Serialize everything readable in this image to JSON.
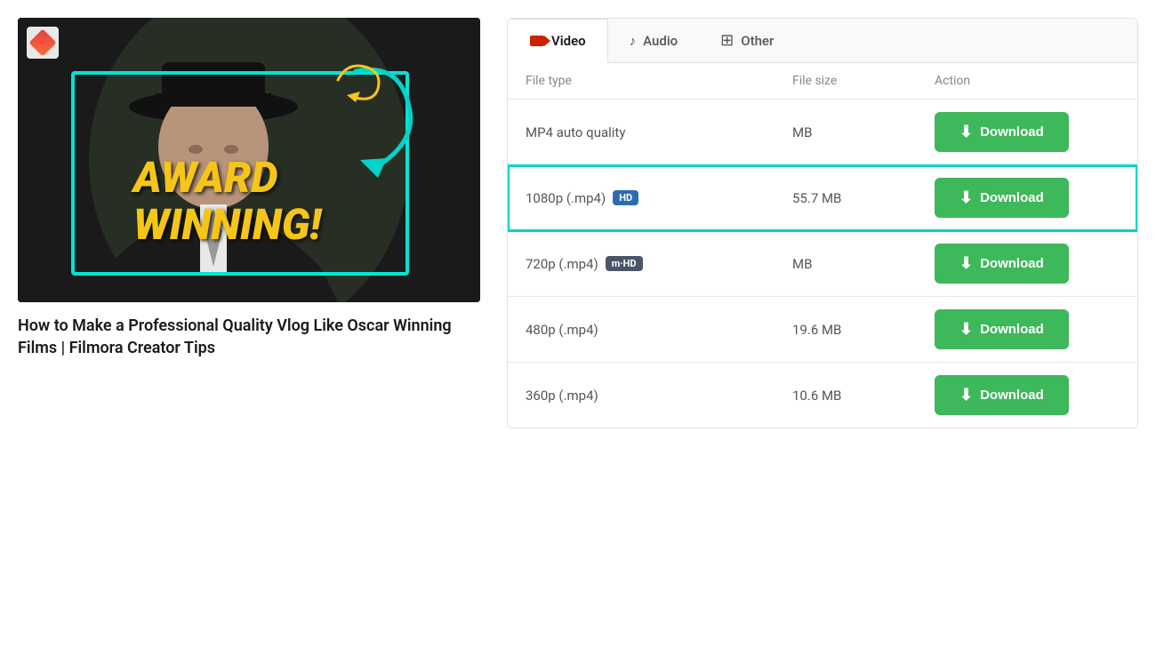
{
  "left": {
    "title": "How to Make a Professional Quality Vlog Like Oscar Winning Films | Filmora Creator Tips"
  },
  "tabs": [
    {
      "id": "video",
      "label": "Video",
      "active": true
    },
    {
      "id": "audio",
      "label": "Audio",
      "active": false
    },
    {
      "id": "other",
      "label": "Other",
      "active": false
    }
  ],
  "table": {
    "columns": {
      "file_type": "File type",
      "file_size": "File size",
      "action": "Action"
    },
    "rows": [
      {
        "id": "mp4-auto",
        "file_type": "MP4 auto quality",
        "badge": null,
        "file_size": "MB",
        "btn_label": "Download",
        "highlighted": false
      },
      {
        "id": "1080p",
        "file_type": "1080p (.mp4)",
        "badge": "HD",
        "badge_class": "hd",
        "file_size": "55.7 MB",
        "btn_label": "Download",
        "highlighted": true
      },
      {
        "id": "720p",
        "file_type": "720p (.mp4)",
        "badge": "m·HD",
        "badge_class": "mhd",
        "file_size": "MB",
        "btn_label": "Download",
        "highlighted": false
      },
      {
        "id": "480p",
        "file_type": "480p (.mp4)",
        "badge": null,
        "file_size": "19.6 MB",
        "btn_label": "Download",
        "highlighted": false
      },
      {
        "id": "360p",
        "file_type": "360p (.mp4)",
        "badge": null,
        "file_size": "10.6 MB",
        "btn_label": "Download",
        "highlighted": false
      }
    ]
  },
  "icons": {
    "download": "⬇",
    "music": "♪",
    "plus": "+"
  }
}
